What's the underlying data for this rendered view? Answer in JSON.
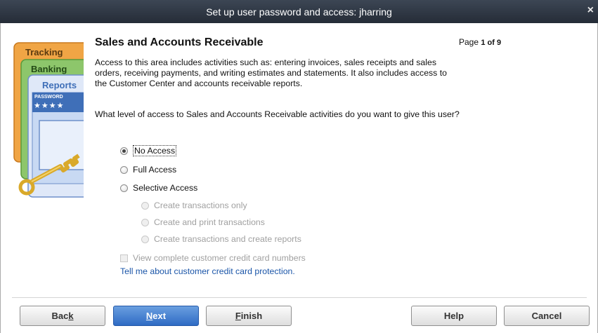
{
  "window": {
    "title": "Set up user password and access: jharring",
    "close_glyph": "×"
  },
  "art": {
    "tab_tracking": "Tracking",
    "tab_banking": "Banking",
    "tab_reports": "Reports",
    "password_label": "PASSWORD",
    "password_stars": "★★★★"
  },
  "section": {
    "heading": "Sales and Accounts Receivable",
    "page_prefix": "Page",
    "page_value": "1 of 9",
    "description": "Access to this area includes activities such as: entering invoices, sales receipts and sales orders, receiving payments, and writing estimates and statements. It also includes access to the Customer Center and accounts receivable reports.",
    "question": "What level of access to Sales and Accounts Receivable activities do you want to give this user?"
  },
  "access_options": {
    "no_access": "No Access",
    "full_access": "Full Access",
    "selective_access": "Selective Access",
    "selected": "No Access"
  },
  "selective_options": {
    "create_only": "Create transactions only",
    "create_print": "Create and print transactions",
    "create_reports": "Create transactions and create reports"
  },
  "credit_card": {
    "checkbox_label": "View complete customer credit card numbers",
    "link_text": "Tell me about customer credit card protection."
  },
  "buttons": {
    "back_pre": "Bac",
    "back_key": "k",
    "next_key": "N",
    "next_post": "ext",
    "finish_key": "F",
    "finish_post": "inish",
    "help": "Help",
    "cancel": "Cancel"
  },
  "colors": {
    "title_bar": "#2f3743",
    "primary_button": "#2f6bc4",
    "link": "#1a55a8"
  }
}
